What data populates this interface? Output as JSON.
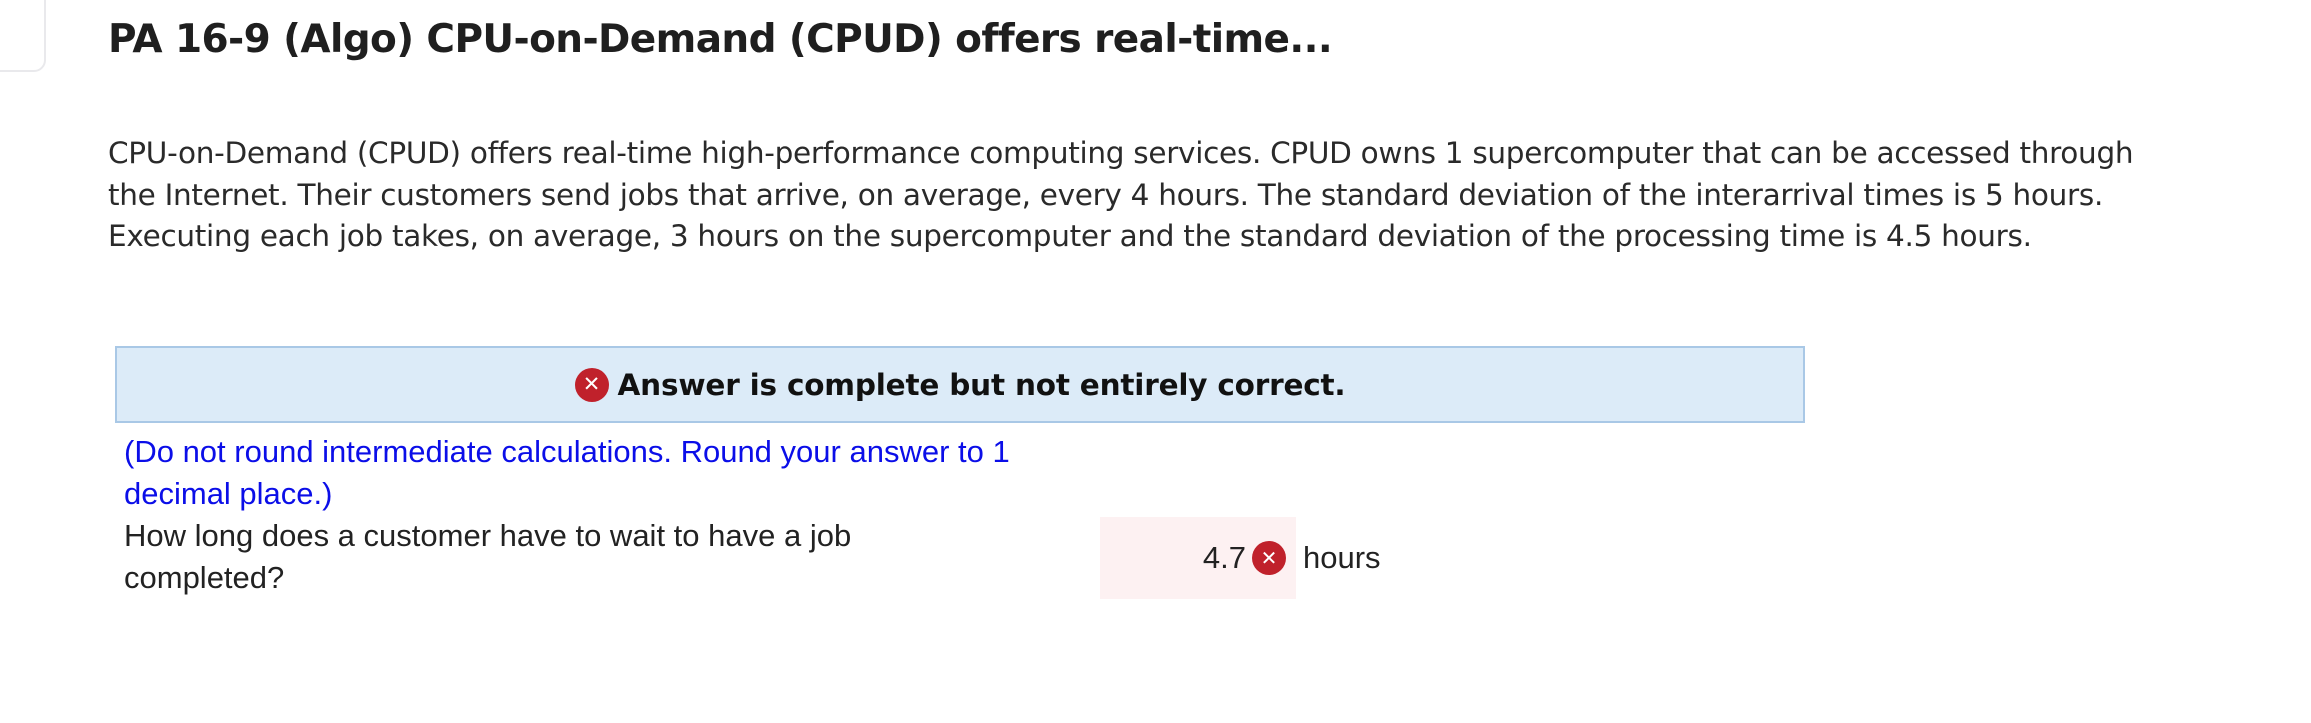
{
  "header": {
    "title": "PA 16-9 (Algo) CPU-on-Demand (CPUD) offers real-time..."
  },
  "problem": {
    "text": "CPU-on-Demand (CPUD) offers real-time high-performance computing services. CPUD owns 1 supercomputer that can be accessed through the Internet. Their customers send jobs that arrive, on average, every 4 hours. The standard deviation of the interarrival times is 5 hours.  Executing each job takes, on average, 3 hours on the supercomputer and the standard deviation of the processing time is 4.5 hours."
  },
  "feedback": {
    "icon": "x-circle-icon",
    "icon_glyph": "✕",
    "message": "Answer is complete but not entirely correct.",
    "colors": {
      "banner_bg": "#dcebf8",
      "banner_border": "#a9c8e6",
      "error_red": "#c0212b"
    }
  },
  "question": {
    "instruction": "(Do not round intermediate calculations. Round your answer to 1 decimal place.)",
    "prompt": "How long does a customer have to wait to have a job completed?",
    "answer_value": "4.7",
    "answer_status_icon": "x-circle-icon",
    "answer_status_glyph": "✕",
    "unit": "hours",
    "colors": {
      "instruction_blue": "#0b0ee8",
      "answer_bg": "#fdf1f2"
    }
  }
}
